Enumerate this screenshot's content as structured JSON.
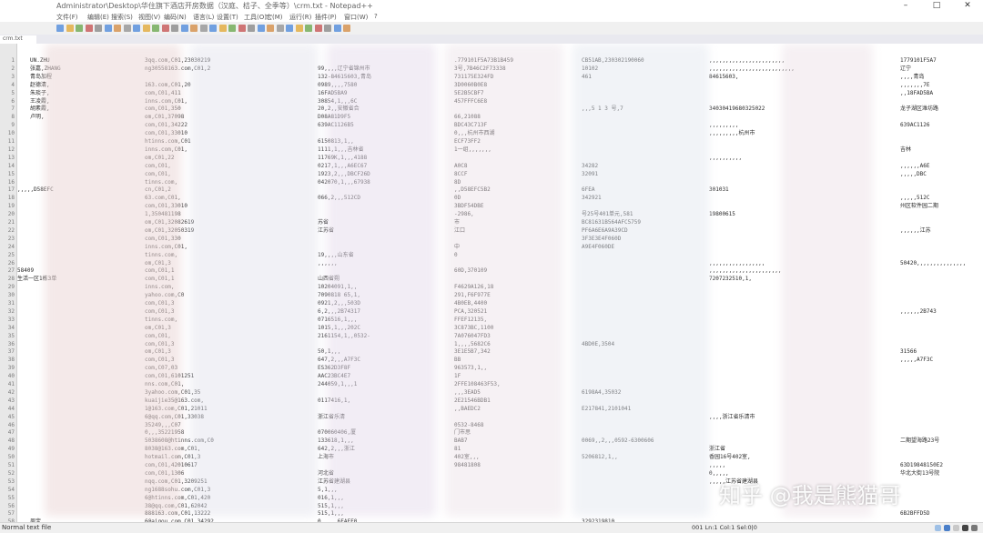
{
  "window": {
    "title": "Administrator\\Desktop\\华住旗下酒店开房数据（汉庭、桔子、全季等）\\crm.txt - Notepad++",
    "controls": [
      "–",
      "□",
      "✕"
    ]
  },
  "menu": [
    "文件(F)",
    "编辑(E)",
    "搜索(S)",
    "视图(V)",
    "编码(N)",
    "语言(L)",
    "设置(T)",
    "工具(O)",
    "宏(M)",
    "运行(R)",
    "插件(P)",
    "窗口(W)",
    "?"
  ],
  "tab": {
    "label": "crm.txt"
  },
  "lines": [
    {
      "n": "1",
      "c": [
        "UN.ZHU",
        "3qq.com,C01,23030219",
        "",
        ".779101F5A73B1B459",
        "CB51AB,230302190060",
        ",,,,,,,,,,,,,,,,,,,,,,,",
        "1779101F5A7"
      ]
    },
    {
      "n": "2",
      "c": [
        "张嘉,ZHANG",
        "ng30558163.com,C01,2",
        "99,,,,辽宁省锦州市",
        "3号,7B46C2F73338",
        "10102",
        ",,,,,,,,,,,,,,,,,,,,,,,,,,",
        "辽宁"
      ]
    },
    {
      "n": "3",
      "c": [
        "青岛加程",
        "",
        "132-84615603,青岛",
        "731175E324FD",
        "461",
        "84615603,",
        ",,,,青岛"
      ]
    },
    {
      "n": "4",
      "c": [
        "赵德清,",
        "163.com,C01,20",
        "0989,,,,7580",
        "3D0060B0E8",
        "",
        "",
        ",,,,,,,7E"
      ]
    },
    {
      "n": "5",
      "c": [
        "朱琰子,",
        "com,C01,411",
        "16FAD5BA9",
        "5E2B5CBF7",
        "",
        "",
        ",,18FAD5BA"
      ]
    },
    {
      "n": "6",
      "c": [
        "王凌霞,",
        "inns.com,C01,",
        "30854,1,,,6C",
        "457FFFC6E8",
        "",
        "",
        ""
      ]
    },
    {
      "n": "7",
      "c": [
        "胡素霞,",
        "com,C01,350",
        "20,2,,安徽省合",
        "",
        ",,,5 1 3 号,7",
        "34030419680325022",
        "龙子湖区潍坊路"
      ]
    },
    {
      "n": "8",
      "c": [
        "卢明,",
        "om,C01,37098",
        "D08A81D9F5",
        "66,21088",
        "",
        "",
        ""
      ]
    },
    {
      "n": "9",
      "c": [
        "",
        "com,C01,34222",
        "639AC1126B5",
        "BDC43C713F",
        "",
        ",,,,,,,,,",
        "639AC1126"
      ]
    },
    {
      "n": "10",
      "c": [
        "",
        "com,C01,33010",
        "",
        "0,,,杭州市西湖",
        "",
        ",,,,,,,,,杭州市",
        ""
      ]
    },
    {
      "n": "11",
      "c": [
        "",
        "htinns.com,C01",
        "6150813,1,,",
        "ECF73FF2",
        "",
        "",
        ""
      ]
    },
    {
      "n": "12",
      "c": [
        "",
        "inns.com,C01,",
        "1111,1,,,吉林省",
        "1一组,,,,,,,",
        "",
        "",
        "吉林"
      ]
    },
    {
      "n": "13",
      "c": [
        "",
        "om,C01,22",
        "11769K,1,,,4188",
        "",
        "",
        ",,,,,,,,,,",
        ""
      ]
    },
    {
      "n": "14",
      "c": [
        "",
        "com,C01,",
        "0217,1,,,A6EC67",
        "A0C8",
        "34282",
        "",
        ",,,,,,A6E"
      ]
    },
    {
      "n": "15",
      "c": [
        "",
        "com,C01,",
        "1923,2,,,DBCF26D",
        "8CCF",
        "32091",
        "",
        ",,,,,DBC"
      ]
    },
    {
      "n": "16",
      "c": [
        "",
        "tinns.com,",
        "042070,1,,,67938",
        "8D",
        "",
        "",
        ""
      ]
    },
    {
      "n": "17",
      "c": [
        "",
        "cn,C01,2",
        "",
        ",,D58EFC5B2",
        "6FEA",
        "301031",
        "",
        ",,,,,D58EFC"
      ]
    },
    {
      "n": "18",
      "c": [
        "",
        "63.com,C01,",
        "066,2,,,512CD",
        "0D",
        "342921",
        "",
        ",,,,,512C"
      ]
    },
    {
      "n": "19",
      "c": [
        "",
        "com,C01,33010",
        "",
        "3BDF54DBE",
        "",
        "",
        " 州区软件园二期"
      ]
    },
    {
      "n": "20",
      "c": [
        "",
        "1,350481198",
        "",
        "-2986,",
        "号25号401单元,581",
        "19800615",
        "",
        ""
      ]
    },
    {
      "n": "21",
      "c": [
        "",
        "om,C01,32082619",
        "苏省",
        "市",
        "BC81631B564AFC5759",
        "",
        "",
        ""
      ]
    },
    {
      "n": "22",
      "c": [
        "",
        "om,C01,32050319",
        "江苏省",
        "江口",
        "PF6A6E6A9A39CD",
        "",
        ",,,,,,江苏",
        ""
      ]
    },
    {
      "n": "23",
      "c": [
        "",
        "com,C01,330",
        "",
        "",
        "3F3E3E4F060D",
        "",
        "",
        ""
      ]
    },
    {
      "n": "24",
      "c": [
        "",
        "inns.com,C01,",
        "",
        "中",
        "A9E4F060DE",
        "",
        ""
      ]
    },
    {
      "n": "25",
      "c": [
        "",
        "tinns.com,",
        "19,,,,山东省",
        "0",
        "",
        "",
        "",
        ""
      ]
    },
    {
      "n": "26",
      "c": [
        "",
        "om,C01,3",
        ",,,,,,",
        "",
        "",
        ",,,,,,,,,,,,,,,,,",
        "50420,,,,,,,,,,,,,,,"
      ]
    },
    {
      "n": "27",
      "c": [
        "",
        "com,C01,1",
        "",
        "60D,370109",
        "",
        ",,,,,,,,,,,,,,,,,,,,,,",
        "",
        "58409"
      ]
    },
    {
      "n": "28",
      "c": [
        "",
        "com,C01,1",
        "山西省朔",
        "",
        "",
        "7207232510,1,",
        "",
        "生活一区1栋3单"
      ]
    },
    {
      "n": "29",
      "c": [
        "",
        "inns.com,",
        "10204091,1,,",
        "F4629A126,18",
        "",
        "",
        ""
      ]
    },
    {
      "n": "30",
      "c": [
        "",
        "yahoo.com,C0",
        "7090818 65,1,",
        "291,F6F977E",
        "",
        "",
        ""
      ]
    },
    {
      "n": "31",
      "c": [
        "",
        "com,C01,3",
        "0921,2,,,503D",
        "4B0EB,4400",
        "",
        "",
        ""
      ]
    },
    {
      "n": "32",
      "c": [
        "",
        "com,C01,3",
        "6,2,,,2B74317",
        "PCA,320521",
        "",
        "",
        ",,,,,,2B743"
      ]
    },
    {
      "n": "33",
      "c": [
        "",
        "tinns.com,",
        "0716516,1,,,",
        "FFEF12135,",
        "",
        "",
        ""
      ]
    },
    {
      "n": "34",
      "c": [
        "",
        "om,C01,3",
        "1015,1,,,202C",
        "3C873BC,1100",
        "",
        "",
        ""
      ]
    },
    {
      "n": "35",
      "c": [
        "",
        "com,C01,",
        "2161154,1,,0532-",
        "7A076047FD3",
        "",
        "",
        ""
      ]
    },
    {
      "n": "36",
      "c": [
        "",
        "com,C01,3",
        "",
        "1,,,,5682C6",
        "4BD0E,3504",
        "",
        "",
        ""
      ]
    },
    {
      "n": "37",
      "c": [
        "",
        "om,C01,3",
        "50,1,,,",
        "3E1E5B7,342",
        "",
        "",
        "31566"
      ]
    },
    {
      "n": "38",
      "c": [
        "",
        "com,C01,3",
        "647,2,,,A7F3C",
        "BB",
        "",
        "",
        ",,,,,A7F3C"
      ]
    },
    {
      "n": "39",
      "c": [
        "",
        "com,C07,03",
        "ES362D3F8F",
        "963573,1,,",
        "",
        "",
        ""
      ]
    },
    {
      "n": "40",
      "c": [
        "",
        "com,C01,6101251",
        "AAC23BC4E7",
        "1F",
        "",
        "",
        ""
      ]
    },
    {
      "n": "41",
      "c": [
        "",
        "nns.com,C01,",
        "244059,1,,,1",
        "2FFE108463F53,",
        "",
        "",
        ""
      ]
    },
    {
      "n": "42",
      "c": [
        "",
        "3yahoo.com,C01,35",
        "",
        ",,,3EAD5",
        "6198A4,35032",
        "",
        "",
        ""
      ]
    },
    {
      "n": "43",
      "c": [
        "",
        "kuaijie35@163.com,",
        "0117416,1,",
        "2E21546BDB1",
        "",
        "",
        ""
      ]
    },
    {
      "n": "44",
      "c": [
        "",
        "1@163.com,C01,21011",
        "",
        ",,BAEDC2",
        "E217841,2101041",
        "",
        "",
        ""
      ]
    },
    {
      "n": "45",
      "c": [
        "",
        "6@qq.com,C01,33038",
        "浙江省乐清",
        "",
        "",
        ",,,,浙江省乐清市",
        ""
      ]
    },
    {
      "n": "46",
      "c": [
        "",
        "35249,,,C07",
        "",
        "0532-8468",
        "",
        "",
        ""
      ]
    },
    {
      "n": "47",
      "c": [
        "",
        "0,,,35221958",
        "070060406,厦",
        "门市思",
        "",
        "",
        "",
        ""
      ]
    },
    {
      "n": "48",
      "c": [
        "",
        "5038608@htinns.com,C0",
        "133618,1,,,",
        "BAB7",
        "0069,,2,,,0592-6300606",
        "",
        "二期望海路23号"
      ]
    },
    {
      "n": "49",
      "c": [
        "",
        "8038@163.com,C01,",
        "642,2,,,浙江",
        "81",
        "",
        "浙江省",
        ""
      ]
    },
    {
      "n": "50",
      "c": [
        "",
        "hotmail.com,C01,3",
        "上海市",
        "402室,,,",
        "5206812,1,,",
        "香园16号402室,"
      ]
    },
    {
      "n": "51",
      "c": [
        "",
        "com,C01,42010617",
        "",
        "98481808",
        "",
        ",,,,,",
        "63D19848150E2"
      ]
    },
    {
      "n": "52",
      "c": [
        "",
        "com,C01,1306",
        "河北省",
        "",
        "",
        "0,,,,,",
        "华北大街13号院"
      ]
    },
    {
      "n": "53",
      "c": [
        "",
        "nqq.com,C01,3209251",
        "江苏省建湖县",
        "",
        "",
        ",,,,,江苏省建湖县",
        ""
      ]
    },
    {
      "n": "54",
      "c": [
        "",
        "ng1688sohu.com,C01,3",
        "5,1,,,",
        "",
        "",
        "",
        ""
      ]
    },
    {
      "n": "55",
      "c": [
        "",
        "6@htinns.com,C01,420",
        "016,1,,,",
        "",
        "",
        "",
        ""
      ]
    },
    {
      "n": "56",
      "c": [
        "",
        "38@qq.com,C01,62042",
        "515,1,,,",
        "",
        "",
        "",
        ""
      ]
    },
    {
      "n": "57",
      "c": [
        "",
        "888163.com,C01,13222",
        "515,1,,,",
        "",
        "",
        "",
        "6B2BFFD5D"
      ]
    },
    {
      "n": "58",
      "c": [
        "周宝",
        "6@aiqou.com,C01,34292",
        "0,,,,,6FAFF0",
        "",
        "3292319810",
        "",
        ""
      ]
    }
  ],
  "status": {
    "left": "Normal text file",
    "right": "001  Ln:1   Col:1   Sel:0|0"
  },
  "watermark": "知乎 @我是熊猫哥",
  "colors": {
    "accent": "#2e7bd6",
    "text": "#2a2a2a"
  },
  "toolbar_icons": [
    "new-file-icon",
    "open-folder-icon",
    "save-icon",
    "save-all-icon",
    "close-icon",
    "close-all-icon",
    "print-icon",
    "cut-icon",
    "copy-icon",
    "paste-icon",
    "undo-icon",
    "redo-icon",
    "find-icon",
    "replace-icon",
    "zoom-in-icon",
    "zoom-out-icon",
    "sync-v-icon",
    "sync-h-icon",
    "word-wrap-icon",
    "all-chars-icon",
    "indent-guide-icon",
    "udl-icon",
    "doc-map-icon",
    "function-list-icon",
    "folder-workspace-icon",
    "monitor-icon",
    "record-macro-icon",
    "stop-macro-icon",
    "play-macro-icon",
    "run-macro-icon",
    "save-macro-icon"
  ]
}
